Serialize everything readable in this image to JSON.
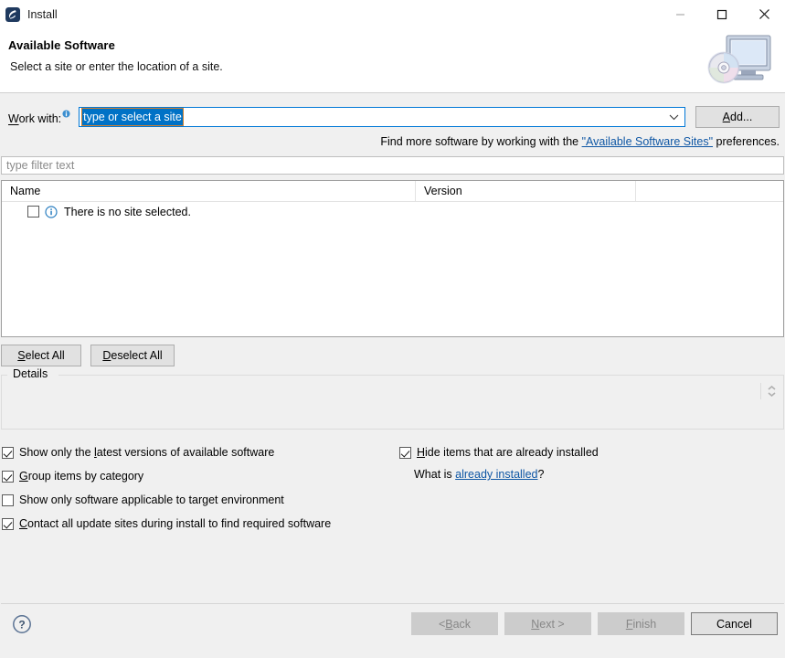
{
  "window": {
    "title": "Install",
    "icon": "eclipse-install-icon",
    "controls": {
      "minimize": "minimize-icon",
      "maximize": "maximize-icon",
      "close": "close-icon"
    }
  },
  "header": {
    "title": "Available Software",
    "subtitle": "Select a site or enter the location of a site.",
    "icon": "monitor-with-disc-icon"
  },
  "work_with": {
    "label_pre": "W",
    "label_post": "ork with:",
    "info_icon": "info-icon",
    "combo_value": "type or select a site",
    "combo_arrow": "chevron-down-icon",
    "add_button_pre": "A",
    "add_button_post": "dd..."
  },
  "find_more": {
    "prefix": "Find more software by working with the ",
    "link": "\"Available Software Sites\"",
    "suffix": " preferences."
  },
  "filter": {
    "placeholder": "type filter text",
    "value": ""
  },
  "table": {
    "columns": [
      "Name",
      "Version"
    ],
    "rows": [
      {
        "checked": false,
        "icon": "info-icon",
        "name": "There is no site selected.",
        "version": ""
      }
    ]
  },
  "selection_buttons": {
    "select_all_pre": "S",
    "select_all_post": "elect All",
    "deselect_all_pre": "D",
    "deselect_all_post": "eselect All"
  },
  "details": {
    "legend": "Details",
    "content": "",
    "spinner_icon": "spinner-up-down-icon"
  },
  "options": {
    "left": [
      {
        "checked": true,
        "pre": "Show only the ",
        "mn": "l",
        "post": "atest versions of available software"
      },
      {
        "checked": true,
        "pre": "",
        "mn": "G",
        "post": "roup items by category"
      },
      {
        "checked": false,
        "pre": "",
        "mn": "S",
        "post": "how only software applicable to target environment"
      },
      {
        "checked": true,
        "pre": "",
        "mn": "C",
        "post": "ontact all update sites during install to find required software"
      }
    ],
    "right": {
      "checked": true,
      "pre": "",
      "mn": "H",
      "post": "ide items that are already installed",
      "whatis_prefix": "What is ",
      "whatis_link": "already installed",
      "whatis_suffix": "?"
    }
  },
  "footer": {
    "help_icon": "help-question-icon",
    "back_pre": "< ",
    "back_mn": "B",
    "back_post": "ack",
    "next_mn": "N",
    "next_post": "ext >",
    "finish_mn": "F",
    "finish_post": "inish",
    "cancel": "Cancel"
  },
  "colors": {
    "accent": "#0072c6",
    "focus_border": "#0078d7",
    "link": "#0e56a4",
    "window_bg": "#f0f0f0",
    "field_bg": "#ffffff",
    "disabled_text": "#878787"
  }
}
